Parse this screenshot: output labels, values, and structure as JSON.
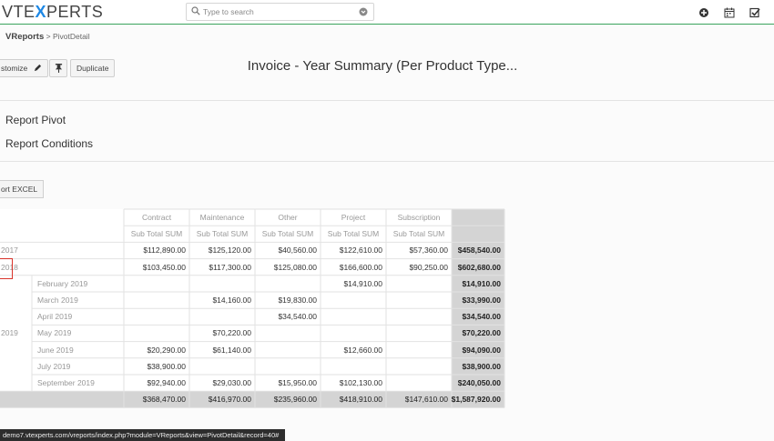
{
  "header": {
    "logo_prefix": "VTE",
    "logo_x": "X",
    "logo_suffix": "PERTS",
    "search_placeholder": "Type to search",
    "icons": [
      "plus-circle-icon",
      "calendar-icon",
      "checkbox-icon"
    ]
  },
  "breadcrumb": {
    "module": "VReports",
    "separator": ">",
    "page": "PivotDetail"
  },
  "toolbar": {
    "customize_label": "stomize",
    "duplicate_label": "Duplicate"
  },
  "report_title": "Invoice - Year Summary (Per Product Type...",
  "sections": {
    "pivot": "Report Pivot",
    "conditions": "Report Conditions"
  },
  "export_label": "ort EXCEL",
  "pivot": {
    "columns": [
      "Contract",
      "Maintenance",
      "Other",
      "Project",
      "Subscription"
    ],
    "subheader": "Sub Total SUM",
    "rows": [
      {
        "year": "2017",
        "month": "",
        "values": [
          "$112,890.00",
          "$125,120.00",
          "$40,560.00",
          "$122,610.00",
          "$57,360.00"
        ],
        "total": "$458,540.00"
      },
      {
        "year": "2018",
        "month": "",
        "values": [
          "$103,450.00",
          "$117,300.00",
          "$125,080.00",
          "$166,600.00",
          "$90,250.00"
        ],
        "total": "$602,680.00"
      },
      {
        "year": "",
        "month": "February 2019",
        "values": [
          "",
          "",
          "",
          "$14,910.00",
          ""
        ],
        "total": "$14,910.00"
      },
      {
        "year": "",
        "month": "March 2019",
        "values": [
          "",
          "$14,160.00",
          "$19,830.00",
          "",
          ""
        ],
        "total": "$33,990.00"
      },
      {
        "year": "",
        "month": "April 2019",
        "values": [
          "",
          "",
          "$34,540.00",
          "",
          ""
        ],
        "total": "$34,540.00"
      },
      {
        "year": "2019",
        "month": "May 2019",
        "values": [
          "",
          "$70,220.00",
          "",
          "",
          ""
        ],
        "total": "$70,220.00"
      },
      {
        "year": "",
        "month": "June 2019",
        "values": [
          "$20,290.00",
          "$61,140.00",
          "",
          "$12,660.00",
          ""
        ],
        "total": "$94,090.00"
      },
      {
        "year": "",
        "month": "July 2019",
        "values": [
          "$38,900.00",
          "",
          "",
          "",
          ""
        ],
        "total": "$38,900.00"
      },
      {
        "year": "",
        "month": "September 2019",
        "values": [
          "$92,940.00",
          "$29,030.00",
          "$15,950.00",
          "$102,130.00",
          ""
        ],
        "total": "$240,050.00"
      }
    ],
    "grand_total": {
      "values": [
        "$368,470.00",
        "$416,970.00",
        "$235,960.00",
        "$418,910.00",
        "$147,610.00"
      ],
      "total": "$1,587,920.00"
    }
  },
  "status_url": "demo7.vtexperts.com/vreports/index.php?module=VReports&view=PivotDetail&record=40#"
}
